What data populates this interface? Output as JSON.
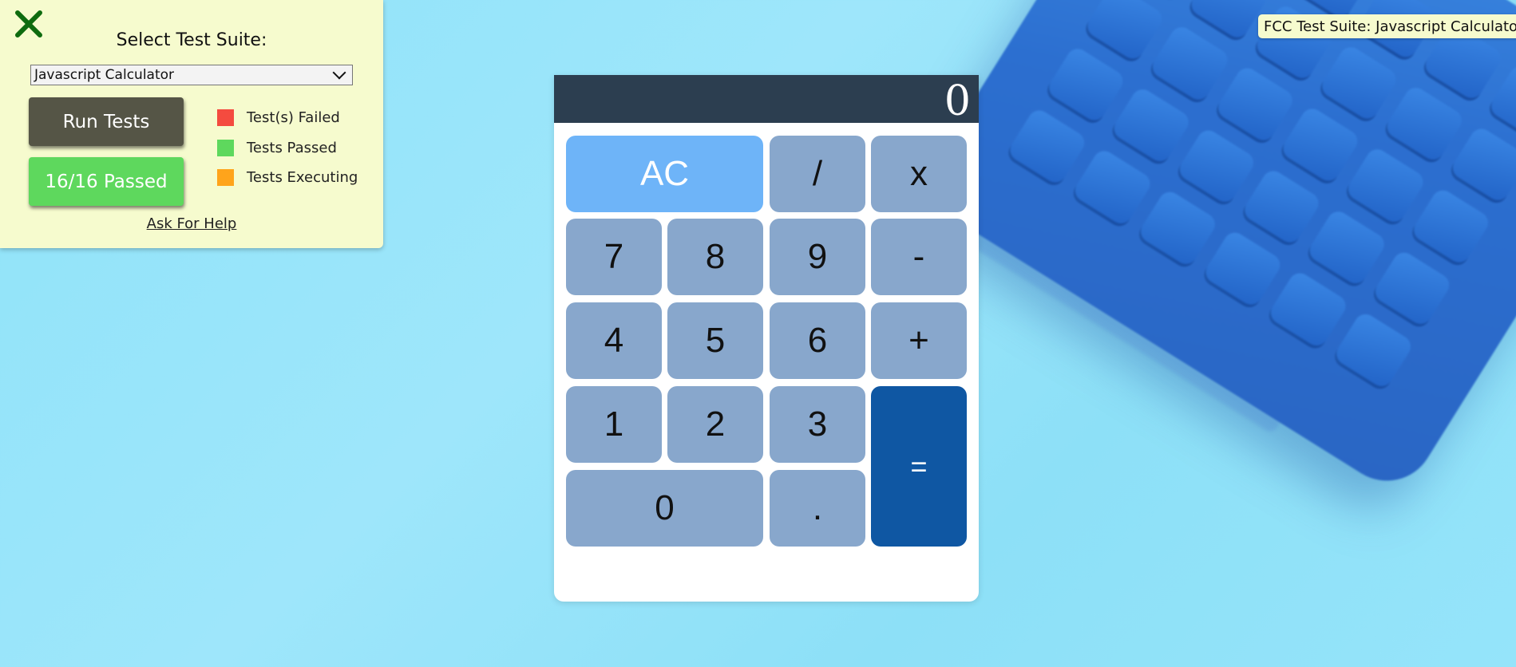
{
  "panel": {
    "title": "Select Test Suite:",
    "selected_suite": "Javascript Calculator",
    "run_button": "Run Tests",
    "result_button": "16/16 Passed",
    "legend": [
      {
        "label": "Test(s) Failed",
        "color": "#f44b3f"
      },
      {
        "label": "Tests Passed",
        "color": "#5ed85d"
      },
      {
        "label": "Tests Executing",
        "color": "#ffa41b"
      }
    ],
    "help_link": "Ask For Help",
    "close_icon": "close-icon"
  },
  "suite_label": "FCC Test Suite: Javascript Calculator",
  "calculator": {
    "display": "0",
    "keys": {
      "clear": "AC",
      "divide": "/",
      "multiply": "x",
      "seven": "7",
      "eight": "8",
      "nine": "9",
      "subtract": "-",
      "four": "4",
      "five": "5",
      "six": "6",
      "add": "+",
      "one": "1",
      "two": "2",
      "three": "3",
      "equals": "=",
      "zero": "0",
      "decimal": "."
    }
  },
  "colors": {
    "display_bg": "#2c3e50",
    "key_bg": "#88a7cc",
    "clear_bg": "#6eb4f8",
    "equals_bg": "#0f57a3",
    "panel_bg": "#f6fbce"
  }
}
